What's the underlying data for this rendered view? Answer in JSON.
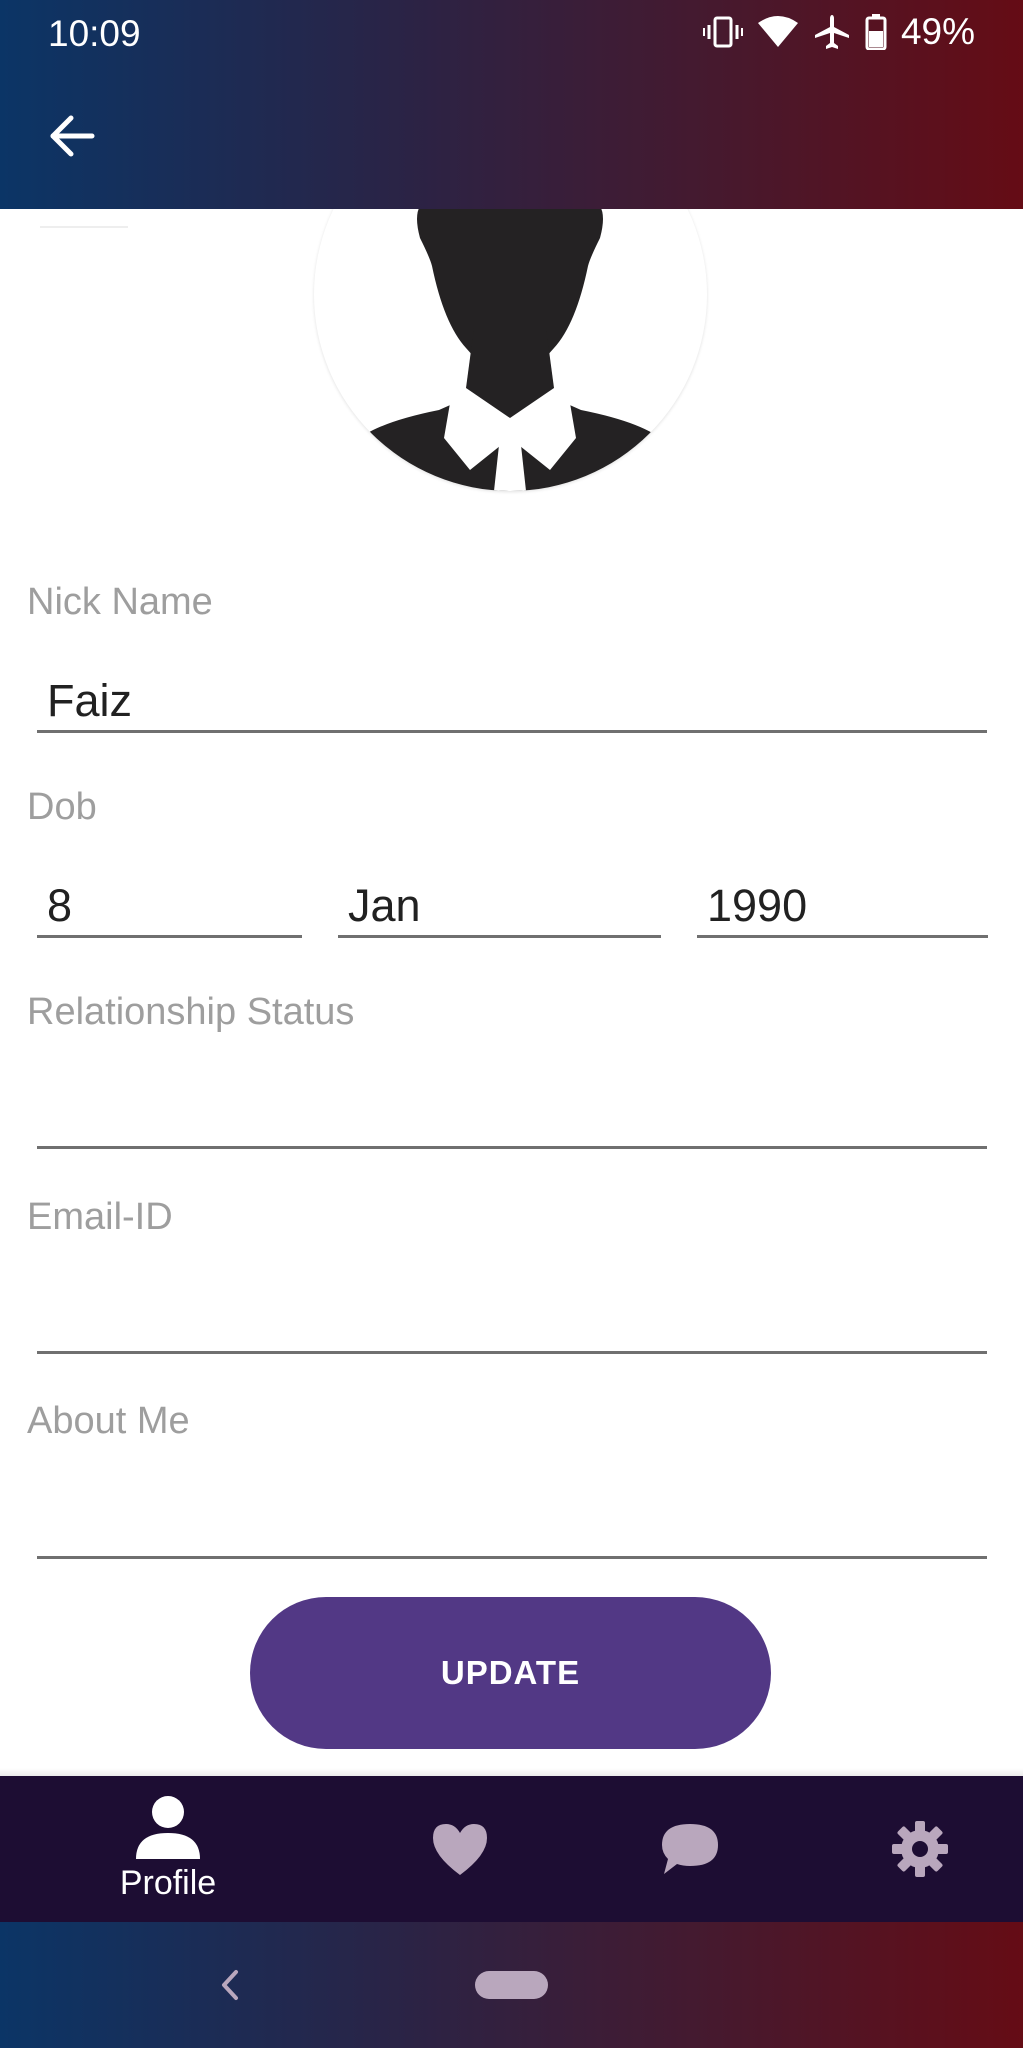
{
  "status_bar": {
    "time": "10:09",
    "battery": "49%",
    "icons": [
      "vibrate-icon",
      "wifi-icon",
      "airplane-icon",
      "battery-icon"
    ]
  },
  "header": {
    "back_icon": "arrow-left-icon"
  },
  "profile": {
    "avatar_icon": "person-silhouette-icon"
  },
  "form": {
    "nick_name": {
      "label": "Nick Name",
      "value": "Faiz"
    },
    "dob": {
      "label": "Dob",
      "day": "8",
      "month": "Jan",
      "year": "1990"
    },
    "relationship_status": {
      "label": "Relationship Status",
      "value": ""
    },
    "email": {
      "label": "Email-ID",
      "value": ""
    },
    "about_me": {
      "label": "About Me",
      "value": ""
    },
    "update_label": "UPDATE"
  },
  "bottom_nav": {
    "items": [
      {
        "label": "Profile",
        "icon": "person-icon",
        "active": true
      },
      {
        "label": "",
        "icon": "heart-icon",
        "active": false
      },
      {
        "label": "",
        "icon": "chat-icon",
        "active": false
      },
      {
        "label": "",
        "icon": "gear-icon",
        "active": false
      }
    ]
  },
  "colors": {
    "accent": "#523885",
    "nav_background": "#1d0d33",
    "gradient_start": "#0b3566",
    "gradient_end": "#650c15",
    "inactive_icon": "#b9a7bd"
  }
}
